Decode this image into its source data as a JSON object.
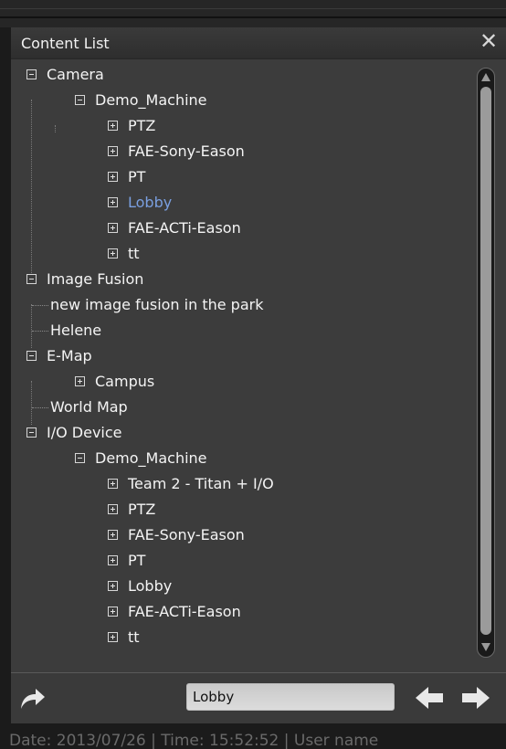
{
  "panel": {
    "title": "Content List"
  },
  "tree": [
    {
      "label": "Camera",
      "depth": 0,
      "expander": "minus"
    },
    {
      "label": "Demo_Machine",
      "depth": 1,
      "expander": "minus"
    },
    {
      "label": "PTZ",
      "depth": 2,
      "expander": "plus"
    },
    {
      "label": "FAE-Sony-Eason",
      "depth": 2,
      "expander": "plus"
    },
    {
      "label": "PT",
      "depth": 2,
      "expander": "plus"
    },
    {
      "label": "Lobby",
      "depth": 2,
      "expander": "plus",
      "selected": true
    },
    {
      "label": "FAE-ACTi-Eason",
      "depth": 2,
      "expander": "plus"
    },
    {
      "label": "tt",
      "depth": 2,
      "expander": "plus"
    },
    {
      "label": "Image Fusion",
      "depth": 0,
      "expander": "minus"
    },
    {
      "label": "new image fusion in the park",
      "depth": 1,
      "expander": "none"
    },
    {
      "label": "Helene",
      "depth": 1,
      "expander": "none"
    },
    {
      "label": "E-Map",
      "depth": 0,
      "expander": "minus"
    },
    {
      "label": "Campus",
      "depth": 1,
      "expander": "plus"
    },
    {
      "label": "World Map",
      "depth": 1,
      "expander": "none"
    },
    {
      "label": "I/O Device",
      "depth": 0,
      "expander": "minus"
    },
    {
      "label": "Demo_Machine",
      "depth": 1,
      "expander": "minus"
    },
    {
      "label": "Team 2 - Titan + I/O",
      "depth": 2,
      "expander": "plus"
    },
    {
      "label": "PTZ",
      "depth": 2,
      "expander": "plus"
    },
    {
      "label": "FAE-Sony-Eason",
      "depth": 2,
      "expander": "plus"
    },
    {
      "label": "PT",
      "depth": 2,
      "expander": "plus"
    },
    {
      "label": "Lobby",
      "depth": 2,
      "expander": "plus"
    },
    {
      "label": "FAE-ACTi-Eason",
      "depth": 2,
      "expander": "plus"
    },
    {
      "label": "tt",
      "depth": 2,
      "expander": "plus"
    }
  ],
  "footer": {
    "search_value": "Lobby",
    "share_icon": "curved-arrow-icon",
    "prev_icon": "arrow-left-icon",
    "next_icon": "arrow-right-icon"
  },
  "status": {
    "text": "Date: 2013/07/26  |  Time: 15:52:52  |  User name"
  },
  "colors": {
    "selected_text": "#7a9fe0",
    "panel_bg": "#3c3c3c"
  }
}
